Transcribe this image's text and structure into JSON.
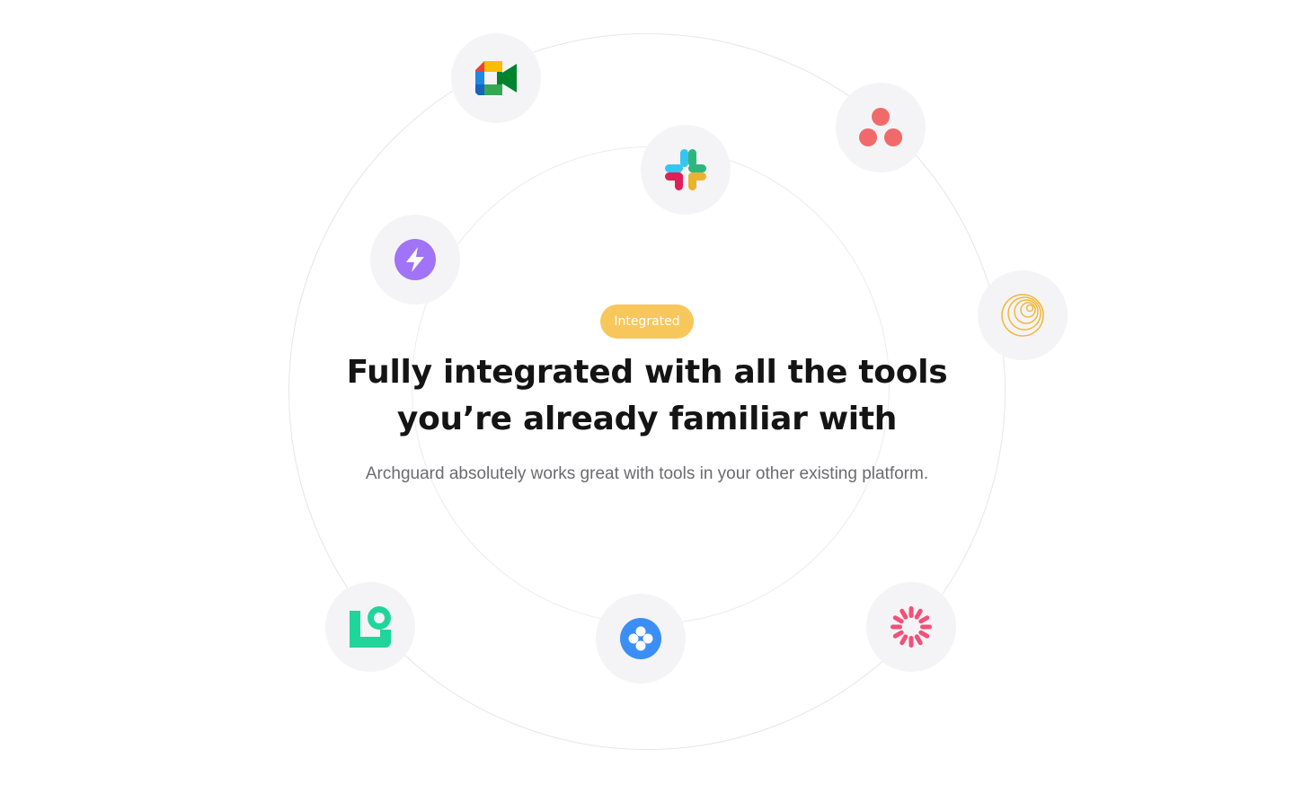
{
  "section": {
    "badge": "Integrated",
    "headline": "Fully integrated with all the tools you’re already familiar with",
    "subtitle": "Archguard absolutely works great with tools in your other existing platform."
  },
  "icons": {
    "google_meet": "google-meet-icon",
    "slack": "slack-icon",
    "asana": "asana-icon",
    "zap": "zap-icon",
    "orbit": "orbit-icon",
    "clickup": "clickup-icon",
    "connect": "connect-icon",
    "sunburst": "sunburst-icon"
  },
  "colors": {
    "badge": "#F7C75C",
    "headline": "#141414",
    "subtitle": "#6B6B70",
    "circle_bg": "#F4F4F6",
    "asana": "#F06A6A",
    "zap": "#A073F7",
    "orbit": "#F4B63A",
    "clickup": "#1ED69A",
    "connect": "#3B8EF5",
    "sunburst": "#F2507A"
  }
}
